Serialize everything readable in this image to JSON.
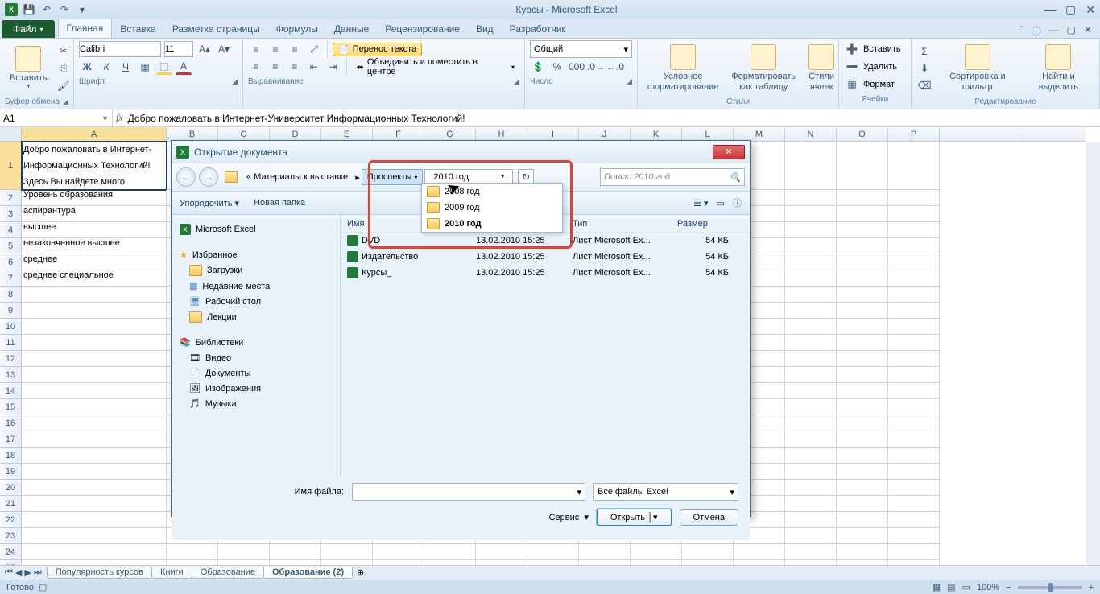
{
  "app": {
    "title": "Курсы - Microsoft Excel"
  },
  "tabs": {
    "file": "Файл",
    "items": [
      "Главная",
      "Вставка",
      "Разметка страницы",
      "Формулы",
      "Данные",
      "Рецензирование",
      "Вид",
      "Разработчик"
    ],
    "active": 0
  },
  "ribbon": {
    "clipboard": {
      "paste": "Вставить",
      "label": "Буфер обмена"
    },
    "font": {
      "name": "Calibri",
      "size": "11",
      "label": "Шрифт"
    },
    "align": {
      "wrap": "Перенос текста",
      "merge": "Объединить и поместить в центре",
      "label": "Выравнивание"
    },
    "number": {
      "format": "Общий",
      "label": "Число"
    },
    "styles": {
      "cond": "Условное форматирование",
      "table": "Форматировать как таблицу",
      "cell": "Стили ячеек",
      "label": "Стили"
    },
    "cells": {
      "insert": "Вставить",
      "delete": "Удалить",
      "format": "Формат",
      "label": "Ячейки"
    },
    "editing": {
      "sort": "Сортировка и фильтр",
      "find": "Найти и выделить",
      "label": "Редактирование"
    }
  },
  "namebox": "A1",
  "formula": "Добро пожаловать в Интернет-Университет Информационных Технологий!",
  "columns": [
    "A",
    "B",
    "C",
    "D",
    "E",
    "F",
    "G",
    "H",
    "I",
    "J",
    "K",
    "L",
    "M",
    "N",
    "O",
    "P"
  ],
  "colA_width": 180,
  "rows": [
    "Добро пожаловать в Интернет-Университете Информационных Технологий! Здесь Вы найдете много бесплатных курсов",
    "Уровень образования",
    "аспирантура",
    "высшее",
    "незаконченное высшее",
    "среднее",
    "среднее специальное"
  ],
  "row1_lines": [
    "Добро пожаловать в Интернет-",
    "Информационных Технологий!",
    "Здесь Вы найдете много бесплатных"
  ],
  "sheets": {
    "items": [
      "Популярность курсов",
      "Книги",
      "Образование",
      "Образование (2)"
    ],
    "active": 3
  },
  "status": {
    "ready": "Готово",
    "zoom": "100%"
  },
  "dialog": {
    "title": "Открытие документа",
    "crumb_prefix": "« Материалы к выставке",
    "crumb_hl": "Проспекты",
    "crumb_current": "2010 год",
    "search_ph": "Поиск: 2010 год",
    "organize": "Упорядочить",
    "newfolder": "Новая папка",
    "side": {
      "excel": "Microsoft Excel",
      "fav": "Избранное",
      "fav_items": [
        "Загрузки",
        "Недавние места",
        "Рабочий стол",
        "Лекции"
      ],
      "lib": "Библиотеки",
      "lib_items": [
        "Видео",
        "Документы",
        "Изображения",
        "Музыка"
      ]
    },
    "headers": {
      "name": "Имя",
      "date": "Дата изменения",
      "type": "Тип",
      "size": "Размер"
    },
    "files": [
      {
        "name": "DVD",
        "date": "13.02.2010 15:25",
        "type": "Лист Microsoft Ex...",
        "size": "54 КБ"
      },
      {
        "name": "Издательство",
        "date": "13.02.2010 15:25",
        "type": "Лист Microsoft Ex...",
        "size": "54 КБ"
      },
      {
        "name": "Курсы_",
        "date": "13.02.2010 15:25",
        "type": "Лист Microsoft Ex...",
        "size": "54 КБ"
      }
    ],
    "dropdown": [
      "2008 год",
      "2009 год",
      "2010 год"
    ],
    "filename_label": "Имя файла:",
    "filter": "Все файлы Excel",
    "tools": "Сервис",
    "open": "Открыть",
    "cancel": "Отмена"
  }
}
